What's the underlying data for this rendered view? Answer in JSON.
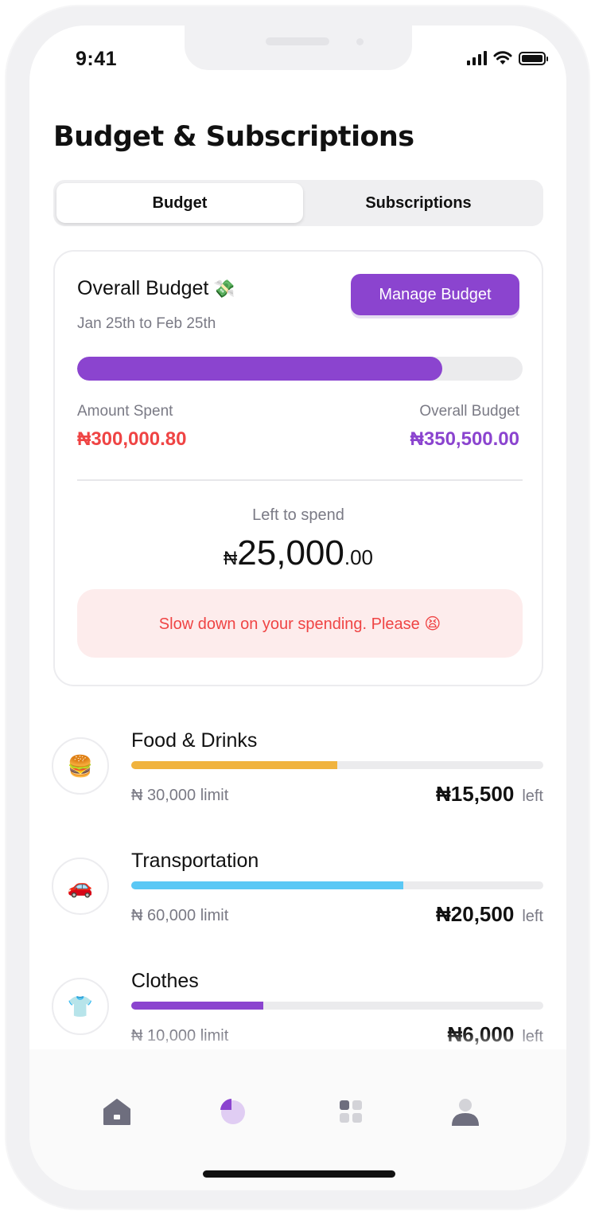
{
  "status_bar": {
    "time": "9:41"
  },
  "page": {
    "title": "Budget & Subscriptions"
  },
  "tabs": {
    "active": "Budget",
    "inactive": "Subscriptions"
  },
  "budget_card": {
    "title": "Overall Budget",
    "title_icon": "money-with-wings-icon",
    "date_range": "Jan 25th to Feb 25th",
    "manage_label": "Manage Budget",
    "progress_fraction": 0.82,
    "spent_label": "Amount Spent",
    "spent_value": "₦300,000.80",
    "overall_label": "Overall Budget",
    "overall_value": "₦350,500.00",
    "left_label": "Left to spend",
    "left_currency": "₦",
    "left_whole": "25,000",
    "left_decimal": ".00",
    "warning": "Slow down on your spending. Please 😫"
  },
  "categories": [
    {
      "icon": "🍔",
      "icon_name": "burger-icon",
      "name": "Food & Drinks",
      "limit": "₦ 30,000 limit",
      "left_amount": "₦15,500",
      "left_label": "left",
      "progress_fraction": 0.5,
      "color": "#f0b33e"
    },
    {
      "icon": "🚗",
      "icon_name": "car-icon",
      "name": "Transportation",
      "limit": "₦ 60,000 limit",
      "left_amount": "₦20,500",
      "left_label": "left",
      "progress_fraction": 0.66,
      "color": "#5ac8f5"
    },
    {
      "icon": "👕",
      "icon_name": "tshirt-icon",
      "name": "Clothes",
      "limit": "₦ 10,000 limit",
      "left_amount": "₦6,000",
      "left_label": "left",
      "progress_fraction": 0.32,
      "color": "#8b44cf"
    }
  ],
  "colors": {
    "accent": "#8b44cf",
    "danger": "#ef4444",
    "muted": "#7a7a85"
  },
  "tabbar": {
    "items": [
      {
        "icon": "home-icon",
        "active": false
      },
      {
        "icon": "pie-chart-icon",
        "active": true
      },
      {
        "icon": "grid-icon",
        "active": false
      },
      {
        "icon": "profile-icon",
        "active": false
      }
    ]
  }
}
